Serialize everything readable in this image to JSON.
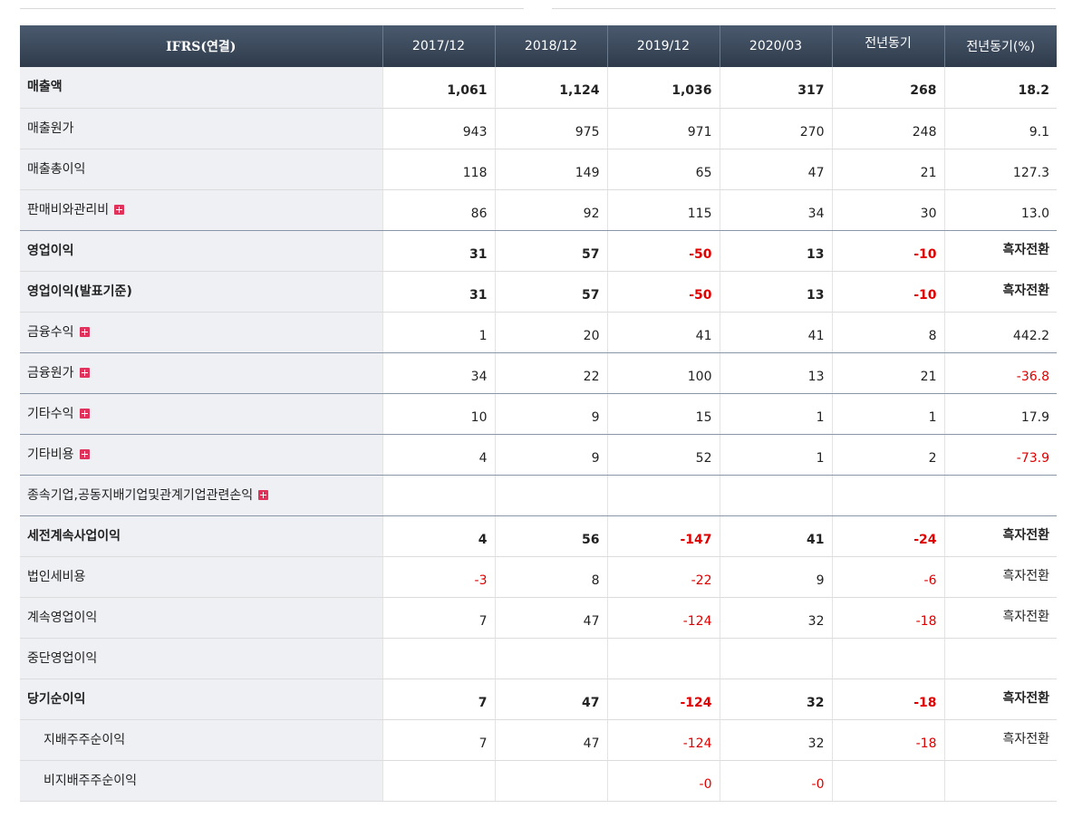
{
  "table": {
    "headers": [
      "IFRS(연결)",
      "2017/12",
      "2018/12",
      "2019/12",
      "2020/03",
      "전년동기",
      "전년동기(%)"
    ],
    "rows": [
      {
        "label": "매출액",
        "bold": true,
        "expand": false,
        "child": false,
        "values": [
          "1,061",
          "1,124",
          "1,036",
          "317",
          "268",
          "18.2"
        ],
        "neg": [
          false,
          false,
          false,
          false,
          false,
          false
        ]
      },
      {
        "label": "매출원가",
        "bold": false,
        "expand": false,
        "child": false,
        "values": [
          "943",
          "975",
          "971",
          "270",
          "248",
          "9.1"
        ],
        "neg": [
          false,
          false,
          false,
          false,
          false,
          false
        ]
      },
      {
        "label": "매출총이익",
        "bold": false,
        "expand": false,
        "child": false,
        "values": [
          "118",
          "149",
          "65",
          "47",
          "21",
          "127.3"
        ],
        "neg": [
          false,
          false,
          false,
          false,
          false,
          false
        ]
      },
      {
        "label": "판매비와관리비",
        "bold": false,
        "expand": true,
        "child": false,
        "values": [
          "86",
          "92",
          "115",
          "34",
          "30",
          "13.0"
        ],
        "neg": [
          false,
          false,
          false,
          false,
          false,
          false
        ],
        "sep": true
      },
      {
        "label": "영업이익",
        "bold": true,
        "expand": false,
        "child": false,
        "values": [
          "31",
          "57",
          "-50",
          "13",
          "-10",
          "흑자전환"
        ],
        "neg": [
          false,
          false,
          true,
          false,
          true,
          false
        ],
        "pctTop": true
      },
      {
        "label": "영업이익(발표기준)",
        "bold": true,
        "expand": false,
        "child": false,
        "values": [
          "31",
          "57",
          "-50",
          "13",
          "-10",
          "흑자전환"
        ],
        "neg": [
          false,
          false,
          true,
          false,
          true,
          false
        ],
        "pctTop": true
      },
      {
        "label": "금융수익",
        "bold": false,
        "expand": true,
        "child": false,
        "values": [
          "1",
          "20",
          "41",
          "41",
          "8",
          "442.2"
        ],
        "neg": [
          false,
          false,
          false,
          false,
          false,
          false
        ],
        "sep": true
      },
      {
        "label": "금융원가",
        "bold": false,
        "expand": true,
        "child": false,
        "values": [
          "34",
          "22",
          "100",
          "13",
          "21",
          "-36.8"
        ],
        "neg": [
          false,
          false,
          false,
          false,
          false,
          true
        ],
        "sep": true
      },
      {
        "label": "기타수익",
        "bold": false,
        "expand": true,
        "child": false,
        "values": [
          "10",
          "9",
          "15",
          "1",
          "1",
          "17.9"
        ],
        "neg": [
          false,
          false,
          false,
          false,
          false,
          false
        ],
        "sep": true
      },
      {
        "label": "기타비용",
        "bold": false,
        "expand": true,
        "child": false,
        "values": [
          "4",
          "9",
          "52",
          "1",
          "2",
          "-73.9"
        ],
        "neg": [
          false,
          false,
          false,
          false,
          false,
          true
        ],
        "sep": true
      },
      {
        "label": "종속기업,공동지배기업및관계기업관련손익",
        "bold": false,
        "expand": true,
        "child": false,
        "values": [
          "",
          "",
          "",
          "",
          "",
          ""
        ],
        "neg": [
          false,
          false,
          false,
          false,
          false,
          false
        ],
        "sep": true
      },
      {
        "label": "세전계속사업이익",
        "bold": true,
        "expand": false,
        "child": false,
        "values": [
          "4",
          "56",
          "-147",
          "41",
          "-24",
          "흑자전환"
        ],
        "neg": [
          false,
          false,
          true,
          false,
          true,
          false
        ],
        "pctTop": true
      },
      {
        "label": "법인세비용",
        "bold": false,
        "expand": false,
        "child": false,
        "values": [
          "-3",
          "8",
          "-22",
          "9",
          "-6",
          "흑자전환"
        ],
        "neg": [
          true,
          false,
          true,
          false,
          true,
          false
        ],
        "pctTop": true
      },
      {
        "label": "계속영업이익",
        "bold": false,
        "expand": false,
        "child": false,
        "values": [
          "7",
          "47",
          "-124",
          "32",
          "-18",
          "흑자전환"
        ],
        "neg": [
          false,
          false,
          true,
          false,
          true,
          false
        ],
        "pctTop": true
      },
      {
        "label": "중단영업이익",
        "bold": false,
        "expand": false,
        "child": false,
        "values": [
          "",
          "",
          "",
          "",
          "",
          ""
        ],
        "neg": [
          false,
          false,
          false,
          false,
          false,
          false
        ]
      },
      {
        "label": "당기순이익",
        "bold": true,
        "expand": false,
        "child": false,
        "values": [
          "7",
          "47",
          "-124",
          "32",
          "-18",
          "흑자전환"
        ],
        "neg": [
          false,
          false,
          true,
          false,
          true,
          false
        ],
        "pctTop": true
      },
      {
        "label": "지배주주순이익",
        "bold": false,
        "expand": false,
        "child": true,
        "values": [
          "7",
          "47",
          "-124",
          "32",
          "-18",
          "흑자전환"
        ],
        "neg": [
          false,
          false,
          true,
          false,
          true,
          false
        ],
        "pctTop": true
      },
      {
        "label": "비지배주주순이익",
        "bold": false,
        "expand": false,
        "child": true,
        "values": [
          "",
          "",
          "-0",
          "-0",
          "",
          ""
        ],
        "neg": [
          false,
          false,
          true,
          true,
          false,
          false
        ]
      }
    ]
  }
}
